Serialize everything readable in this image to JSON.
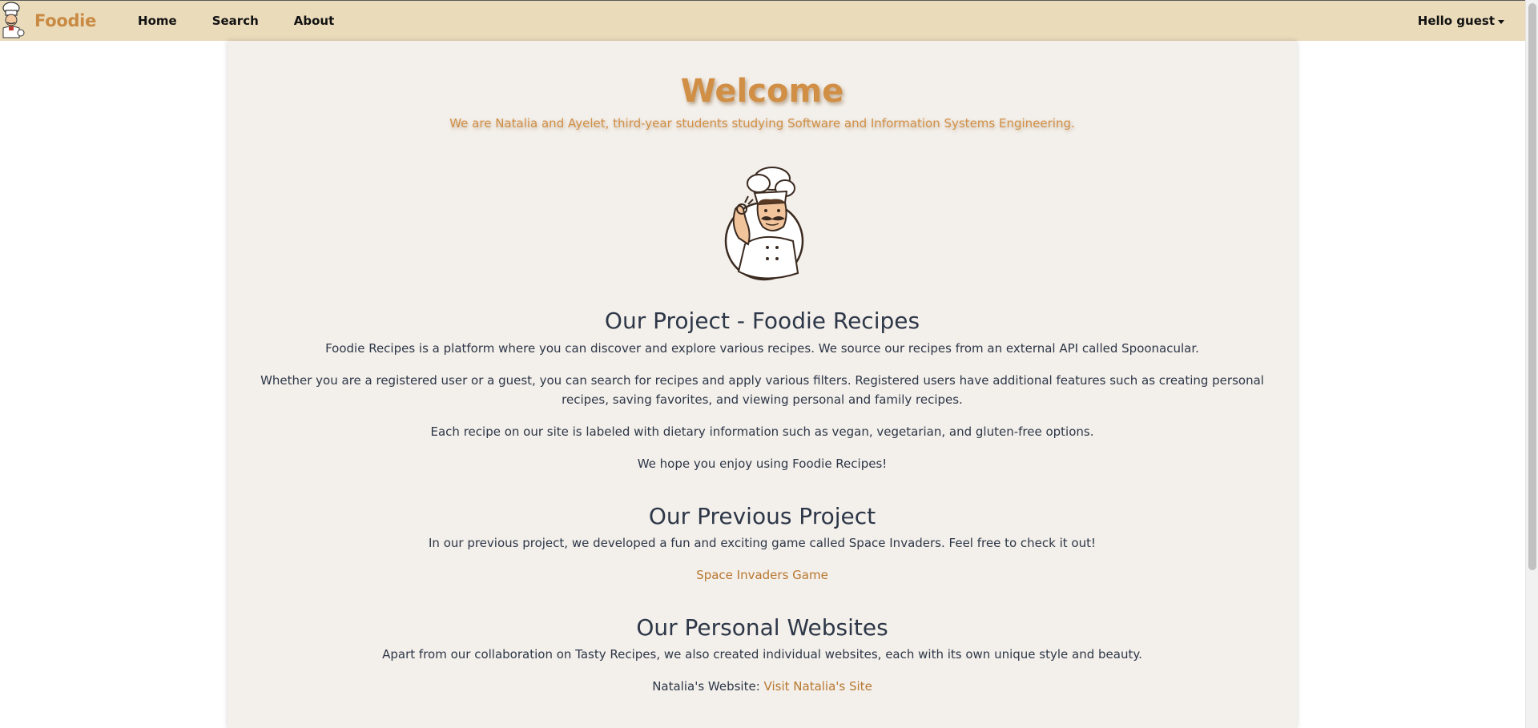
{
  "navbar": {
    "brand": "Foodie",
    "links": [
      "Home",
      "Search",
      "About"
    ],
    "user_greeting": "Hello guest"
  },
  "hero": {
    "title": "Welcome",
    "subtitle": "We are Natalia and Ayelet, third-year students studying Software and Information Systems Engineering."
  },
  "project": {
    "heading": "Our Project - Foodie Recipes",
    "paragraphs": [
      "Foodie Recipes is a platform where you can discover and explore various recipes. We source our recipes from an external API called Spoonacular.",
      "Whether you are a registered user or a guest, you can search for recipes and apply various filters. Registered users have additional features such as creating personal recipes, saving favorites, and viewing personal and family recipes.",
      "Each recipe on our site is labeled with dietary information such as vegan, vegetarian, and gluten-free options.",
      "We hope you enjoy using Foodie Recipes!"
    ]
  },
  "previous": {
    "heading": "Our Previous Project",
    "text": "In our previous project, we developed a fun and exciting game called Space Invaders. Feel free to check it out!",
    "link": "Space Invaders Game"
  },
  "personal": {
    "heading": "Our Personal Websites",
    "text": "Apart from our collaboration on Tasty Recipes, we also created individual websites, each with its own unique style and beauty.",
    "natalia_label": "Natalia's Website:",
    "natalia_link": "Visit Natalia's Site"
  },
  "colors": {
    "navbar_bg": "#eadbbb",
    "accent": "#d18f45",
    "link": "#b87730",
    "panel_bg": "#f3efea",
    "text": "#2d3748"
  },
  "icons": {
    "brand_logo": "chef-logo-icon",
    "hero_image": "chef-illustration"
  }
}
